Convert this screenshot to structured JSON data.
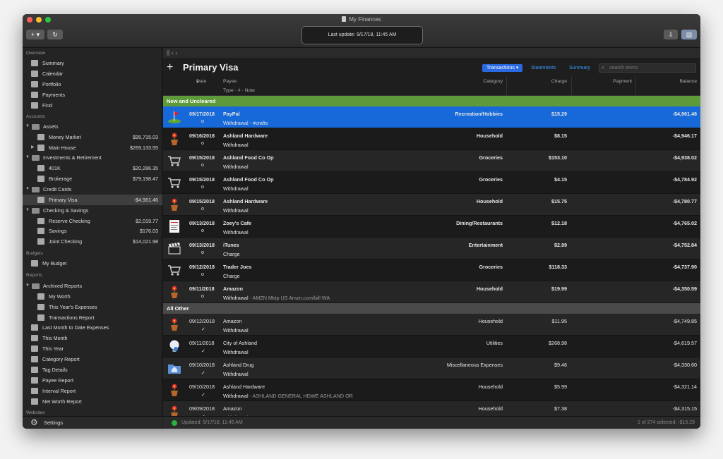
{
  "window": {
    "title": "My Finances",
    "last_update": "Last update: 9/17/18, 11:45 AM"
  },
  "colors": {
    "accent": "#1769d9",
    "group_green": "#5e9a3a",
    "group_gray": "#4a4a4a"
  },
  "sidebar": {
    "overview_label": "Overview",
    "overview": [
      {
        "label": "Summary",
        "icon": "bank-icon"
      },
      {
        "label": "Calendar",
        "icon": "calendar-icon"
      },
      {
        "label": "Portfolio",
        "icon": "chart-icon"
      },
      {
        "label": "Payments",
        "icon": "payments-icon"
      },
      {
        "label": "Find",
        "icon": "magnifier-icon"
      }
    ],
    "accounts_label": "Accounts",
    "groups": {
      "assets": "Assets",
      "investments": "Investments & Retirement",
      "credit": "Credit Cards",
      "checking": "Checking & Savings"
    },
    "accounts": {
      "money_market": {
        "label": "Money Market",
        "amount": "$95,715.03"
      },
      "main_house": {
        "label": "Main House",
        "amount": "$269,133.55"
      },
      "k401": {
        "label": "401K",
        "amount": "$20,286.35"
      },
      "brokerage": {
        "label": "Brokerage",
        "amount": "$79,198.47"
      },
      "primary_visa": {
        "label": "Primary Visa",
        "amount": "-$4,961.46"
      },
      "reserve": {
        "label": "Reserve Checking",
        "amount": "$2,019.77"
      },
      "savings": {
        "label": "Savings",
        "amount": "$176.03"
      },
      "joint": {
        "label": "Joint Checking",
        "amount": "$14,021.98"
      }
    },
    "budgets_label": "Budgets",
    "my_budget": "My Budget",
    "reports_label": "Reports",
    "archived": "Archived Reports",
    "archived_items": [
      "My Worth",
      "This Year's Expenses",
      "Transactions Report"
    ],
    "reports": [
      "Last Month to Date Expenses",
      "This Month",
      "This Year",
      "Category Report",
      "Tag Details",
      "Payee Report",
      "Interval Report",
      "Net Worth Report"
    ],
    "websites_label": "Websites",
    "settings": "Settings"
  },
  "main": {
    "title": "Primary Visa",
    "tabs": [
      "Transactions",
      "Statements",
      "Summary"
    ],
    "search_placeholder": "search terms",
    "columns": {
      "date": "Date",
      "payee": "Payee",
      "sub": "Type  ·  #  ·  Note",
      "category": "Category",
      "charge": "Charge",
      "payment": "Payment",
      "balance": "Balance"
    },
    "group1": "New and Uncleared",
    "group2": "All Other",
    "rows1": [
      {
        "date": "09/17/2018",
        "payee": "PayPal",
        "category": "Recreation/Hobbies",
        "charge": "$15.29",
        "balance": "-$4,961.46",
        "type": "Withdrawal",
        "note": " - #crafts",
        "mark": "o",
        "icon": "golf-flag-icon",
        "sel": true
      },
      {
        "date": "09/16/2018",
        "payee": "Ashland Hardware",
        "category": "Household",
        "charge": "$8.15",
        "balance": "-$4,946.17",
        "type": "Withdrawal",
        "note": "",
        "mark": "o",
        "icon": "flowerpot-icon"
      },
      {
        "date": "09/15/2018",
        "payee": "Ashland Food Co Op",
        "category": "Groceries",
        "charge": "$153.10",
        "balance": "-$4,938.02",
        "type": "Withdrawal",
        "note": "",
        "mark": "o",
        "icon": "shopping-cart-icon"
      },
      {
        "date": "09/15/2018",
        "payee": "Ashland Food Co Op",
        "category": "Groceries",
        "charge": "$4.15",
        "balance": "-$4,784.92",
        "type": "Withdrawal",
        "note": "",
        "mark": "o",
        "icon": "shopping-cart-icon"
      },
      {
        "date": "09/15/2018",
        "payee": "Ashland Hardware",
        "category": "Household",
        "charge": "$15.75",
        "balance": "-$4,780.77",
        "type": "Withdrawal",
        "note": "",
        "mark": "o",
        "icon": "flowerpot-icon"
      },
      {
        "date": "09/13/2018",
        "payee": "Zoey's Cafe",
        "category": "Dining/Restaurants",
        "charge": "$12.18",
        "balance": "-$4,765.02",
        "type": "Withdrawal",
        "note": "",
        "mark": "o",
        "icon": "menu-icon"
      },
      {
        "date": "09/13/2018",
        "payee": "iTunes",
        "category": "Entertainment",
        "charge": "$2.99",
        "balance": "-$4,752.84",
        "type": "Charge",
        "note": "",
        "mark": "o",
        "icon": "clapperboard-icon"
      },
      {
        "date": "09/12/2018",
        "payee": "Trader Joes",
        "category": "Groceries",
        "charge": "$118.33",
        "balance": "-$4,737.90",
        "type": "Charge",
        "note": "",
        "mark": "o",
        "icon": "shopping-cart-icon"
      },
      {
        "date": "09/11/2018",
        "payee": "Amazon",
        "category": "Household",
        "charge": "$19.99",
        "balance": "-$4,350.59",
        "type": "Withdrawal",
        "note": " - AMZN Mktp US Amzn.com/bill WA",
        "mark": "o",
        "icon": "flowerpot-icon"
      }
    ],
    "rows2": [
      {
        "date": "09/12/2018",
        "payee": "Amazon",
        "category": "Household",
        "charge": "$11.95",
        "balance": "-$4,749.85",
        "type": "Withdrawal",
        "note": "",
        "mark": "✓",
        "icon": "flowerpot-icon"
      },
      {
        "date": "09/11/2018",
        "payee": "City of Ashland",
        "category": "Utilities",
        "charge": "$268.98",
        "balance": "-$4,619.57",
        "type": "Withdrawal",
        "note": "",
        "mark": "✓",
        "icon": "bulb-icon"
      },
      {
        "date": "09/10/2018",
        "payee": "Ashland Drug",
        "category": "Miscellaneous Expenses",
        "charge": "$9.46",
        "balance": "-$4,330.60",
        "type": "Withdrawal",
        "note": "",
        "mark": "✓",
        "icon": "folder-icon"
      },
      {
        "date": "09/10/2018",
        "payee": "Ashland Hardware",
        "category": "Household",
        "charge": "$5.99",
        "balance": "-$4,321.14",
        "type": "Withdrawal",
        "note": " - ASHLAND GENERAL HDWE ASHLAND OR",
        "mark": "✓",
        "icon": "flowerpot-icon"
      },
      {
        "date": "09/09/2018",
        "payee": "Amazon",
        "category": "Household",
        "charge": "$7.38",
        "balance": "-$4,315.15",
        "type": "Withdrawal",
        "note": "",
        "mark": "✓",
        "icon": "flowerpot-icon"
      }
    ],
    "status_left": "Updated: 9/17/18, 11:45 AM",
    "status_right": "1 of 274 selected: -$15.29"
  }
}
